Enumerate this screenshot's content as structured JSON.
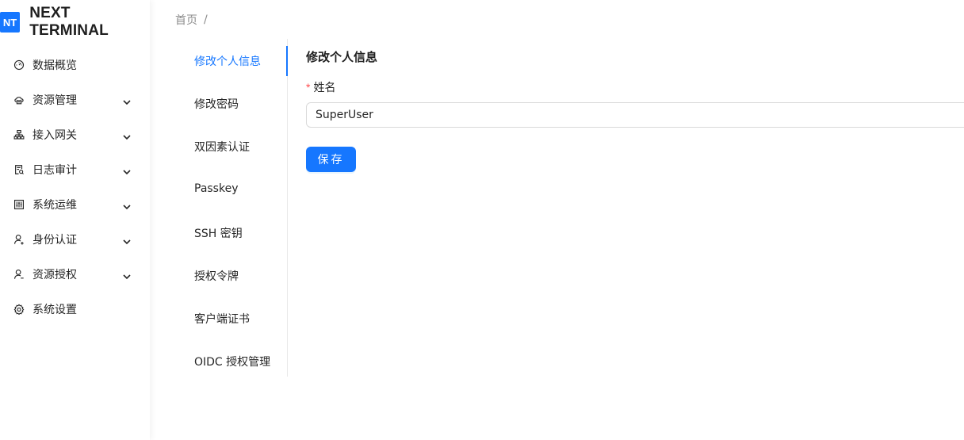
{
  "app": {
    "logo_badge": "NT",
    "title": "NEXT TERMINAL"
  },
  "sidebar": {
    "items": [
      {
        "label": "数据概览",
        "icon": "dashboard-icon",
        "has_children": false
      },
      {
        "label": "资源管理",
        "icon": "cloud-server-icon",
        "has_children": true
      },
      {
        "label": "接入网关",
        "icon": "gateway-icon",
        "has_children": true
      },
      {
        "label": "日志审计",
        "icon": "audit-log-icon",
        "has_children": true
      },
      {
        "label": "系统运维",
        "icon": "control-panel-icon",
        "has_children": true
      },
      {
        "label": "身份认证",
        "icon": "user-identity-icon",
        "has_children": true
      },
      {
        "label": "资源授权",
        "icon": "user-authorize-icon",
        "has_children": true
      },
      {
        "label": "系统设置",
        "icon": "gear-icon",
        "has_children": false
      }
    ]
  },
  "breadcrumb": {
    "home": "首页",
    "separator": "/"
  },
  "tabs": {
    "active_index": 0,
    "items": [
      {
        "label": "修改个人信息"
      },
      {
        "label": "修改密码"
      },
      {
        "label": "双因素认证"
      },
      {
        "label": "Passkey"
      },
      {
        "label": "SSH 密钥"
      },
      {
        "label": "授权令牌"
      },
      {
        "label": "客户端证书"
      },
      {
        "label": "OIDC 授权管理"
      }
    ]
  },
  "form": {
    "title": "修改个人信息",
    "required_mark": "*",
    "name_label": "姓名",
    "name_value": "SuperUser",
    "save_label": "保存"
  },
  "colors": {
    "accent": "#1677ff",
    "required": "#ff4d4f"
  }
}
